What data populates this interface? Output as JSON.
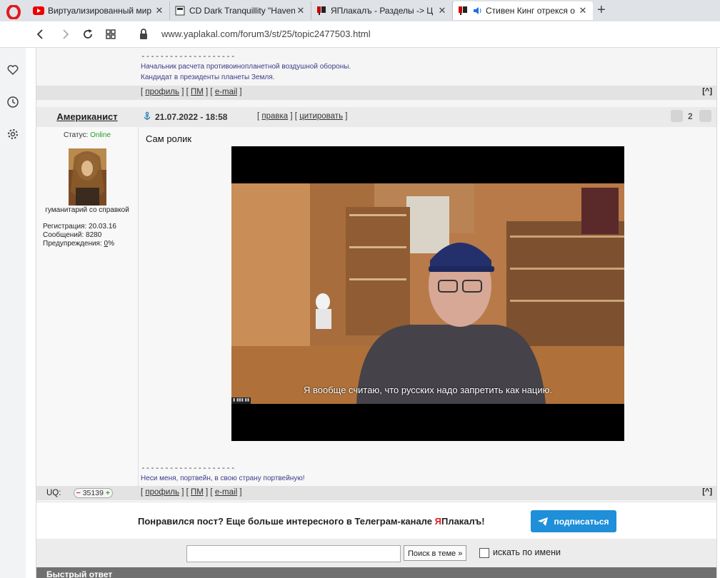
{
  "browser": {
    "tabs": [
      {
        "title": "Виртуализированный мир",
        "icon": "youtube-icon"
      },
      {
        "title": "CD Dark Tranquillity \"Haven",
        "icon": "page-icon"
      },
      {
        "title": "ЯПлакалъ - Разделы -> Ц",
        "icon": "yaplakal-icon"
      },
      {
        "title": "Стивен Кинг отрекся о",
        "icon": "yaplakal-icon"
      }
    ],
    "url": "www.yaplakal.com/forum3/st/25/topic2477503.html"
  },
  "prev_post": {
    "sig_separator": "--------------------",
    "sig_line1": "Начальник расчета противоинопланетной воздушной обороны.",
    "sig_line2": "Кандидат в президенты планеты Земля."
  },
  "links": {
    "profile": "профиль",
    "pm": "ПМ",
    "email": "e-mail",
    "to_top": "[^]",
    "edit": "правка",
    "quote": "цитировать"
  },
  "post": {
    "author": "Американист",
    "status_label": "Статус:",
    "status_value": "Online",
    "rank": "гуманитарий со справкой",
    "reg_label": "Регистрация:",
    "reg_value": "20.03.16",
    "msgs_label": "Сообщений:",
    "msgs_value": "8280",
    "warn_label": "Предупреждения:",
    "warn_value": "0",
    "warn_pct": "%",
    "datetime": "21.07.2022 - 18:58",
    "rating": "2",
    "text": "Сам ролик",
    "video_subtitle": "Я вообще считаю, что русских надо запретить как нацию.",
    "sig_separator": "--------------------",
    "signature": "Неси меня, портвейн, в свою страну портвейную!",
    "uq_label": "UQ:",
    "uq_value": "35139"
  },
  "promo": {
    "text_a": "Понравился пост? Еще больше интересного в Телеграм-канале ",
    "text_ya": "Я",
    "text_b": "Плакалъ!",
    "button": "подписаться"
  },
  "search": {
    "button": "Поиск в теме »",
    "checkbox_label": "искать по имени"
  },
  "quick_reply": "Быстрый ответ"
}
